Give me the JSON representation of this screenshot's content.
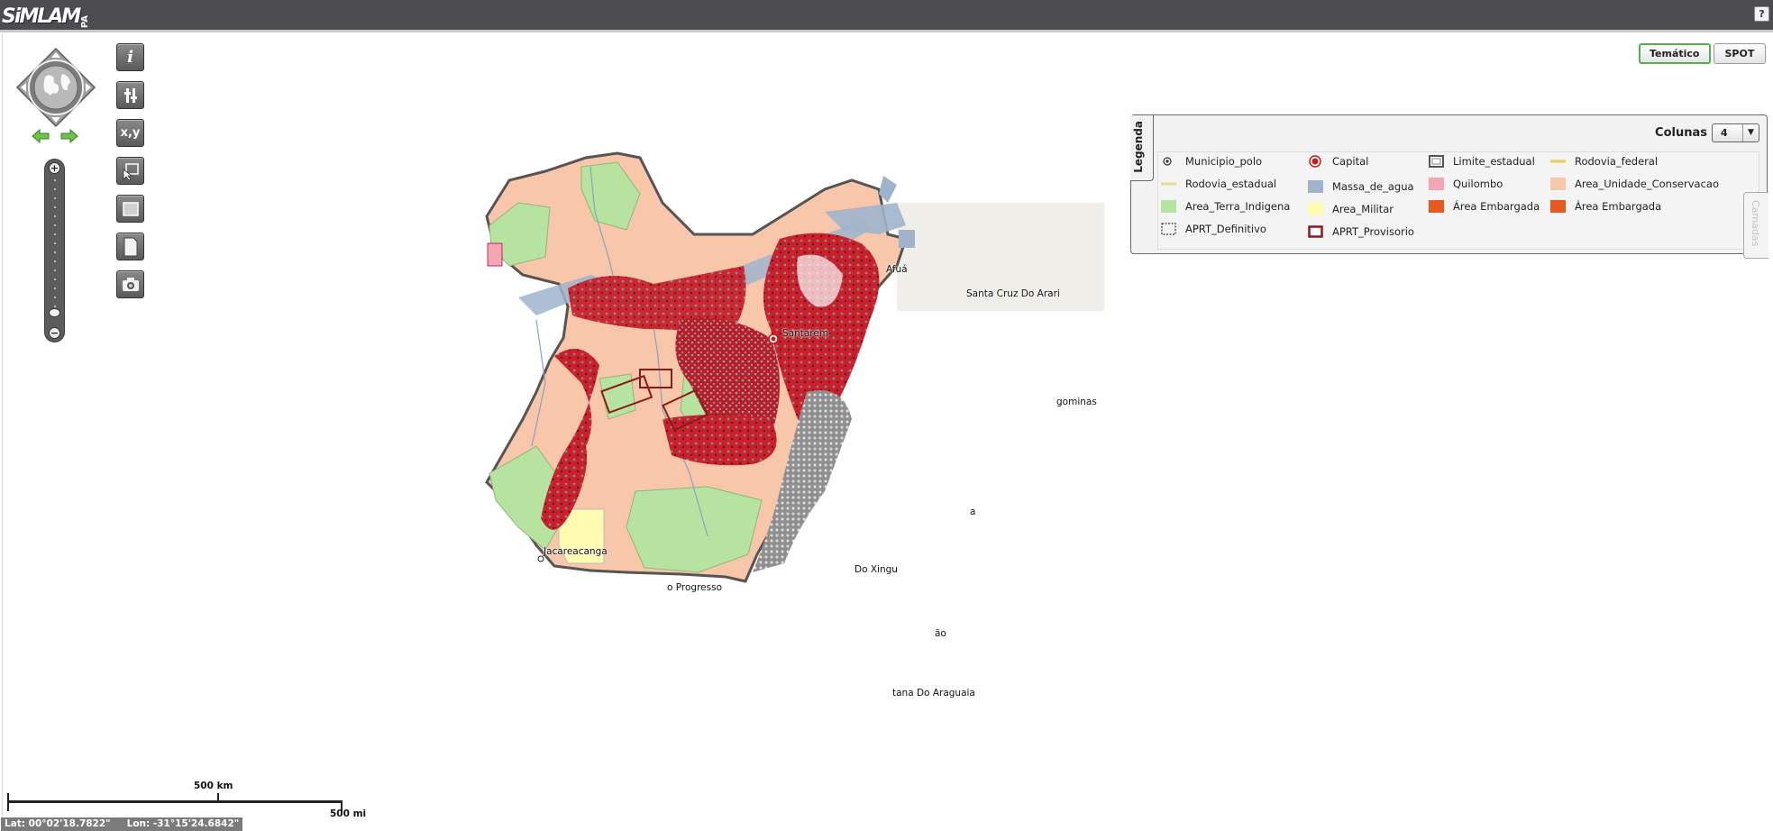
{
  "header": {
    "logo_main": "SiMLAM",
    "logo_sub": "PA",
    "help_label": "?"
  },
  "tools": {
    "info_label": "i",
    "xy_label": "x,y",
    "pdf_label": "PDF"
  },
  "zoom": {
    "plus_label": "+",
    "minus_label": "−"
  },
  "map_toggle": {
    "tematico_label": "Temático",
    "spot_label": "SPOT",
    "active": "Temático"
  },
  "legend": {
    "tab_label": "Legenda",
    "colunas_label": "Colunas",
    "colunas_value": "4",
    "items": [
      {
        "label": "Municipio_polo",
        "symbol": "dot-circle",
        "color": "#333333"
      },
      {
        "label": "Capital",
        "symbol": "red-circle",
        "color": "#c81a1a"
      },
      {
        "label": "Limite_estadual",
        "symbol": "box-outline",
        "color": "#555555"
      },
      {
        "label": "Rodovia_federal",
        "symbol": "line",
        "color": "#f2c94c"
      },
      {
        "label": "Rodovia_estadual",
        "symbol": "line",
        "color": "#e4de8c"
      },
      {
        "label": "Massa_de_agua",
        "symbol": "fill",
        "color": "#9fb4cc"
      },
      {
        "label": "Quilombo",
        "symbol": "fill",
        "color": "#f5a6b4"
      },
      {
        "label": "Area_Unidade_Conservacao",
        "symbol": "fill",
        "color": "#f8c6a8"
      },
      {
        "label": "Area_Terra_Indigena",
        "symbol": "fill",
        "color": "#b6e3a0"
      },
      {
        "label": "Area_Militar",
        "symbol": "fill",
        "color": "#fdfcb0"
      },
      {
        "label": "Área Embargada",
        "symbol": "fill",
        "color": "#e8591e"
      },
      {
        "label": "Área Embargada",
        "symbol": "fill",
        "color": "#e8591e"
      },
      {
        "label": "APRT_Definitivo",
        "symbol": "dashed-box",
        "color": "#333333"
      },
      {
        "label": "APRT_Provisorio",
        "symbol": "thick-outline",
        "color": "#8b1a1a"
      }
    ]
  },
  "side_tab_label": "Camadas",
  "map_labels": {
    "afua": "Afuá",
    "santa_cruz": "Santa Cruz Do Arari",
    "santarem": "Santarém",
    "paragominas": "gominas",
    "jacareacanga": "Jacareacanga",
    "novo_progresso": "o Progresso",
    "sao_felix": "Do Xingu",
    "redencao": "ão",
    "santana": "tana Do Araguaia",
    "tucurui": "a"
  },
  "scale": {
    "km_label": "500 km",
    "mi_label": "500 mi"
  },
  "coordinates": {
    "lat": "Lat: 00°02'18.7822\"",
    "lon": "Lon: -31°15'24.6842\""
  }
}
